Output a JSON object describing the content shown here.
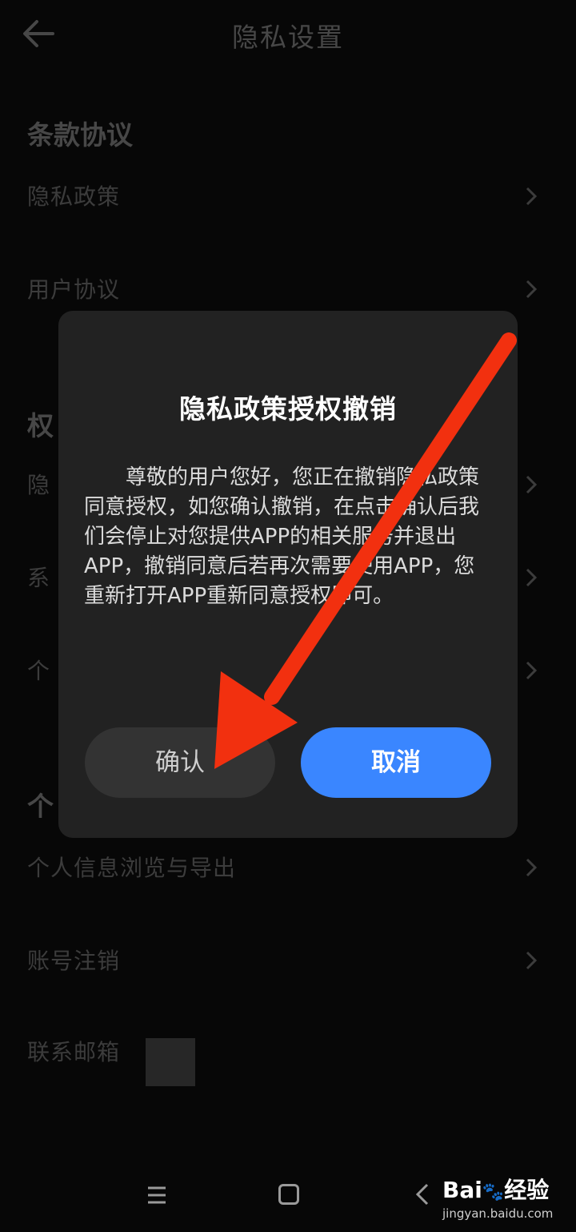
{
  "header": {
    "title": "隐私设置",
    "back_icon": "arrow-left-icon"
  },
  "sections": {
    "terms": {
      "title": "条款协议",
      "items": [
        {
          "label": "隐私政策"
        },
        {
          "label": "用户协议"
        }
      ]
    },
    "permissions": {
      "title_visible": "权",
      "items": [
        {
          "label_visible": "隐"
        },
        {
          "label_visible": "系"
        },
        {
          "label_visible": "个"
        }
      ]
    },
    "personal": {
      "title_visible": "个",
      "items": [
        {
          "label": "个人信息浏览与导出"
        },
        {
          "label": "账号注销"
        },
        {
          "label": "联系邮箱"
        }
      ]
    }
  },
  "dialog": {
    "title": "隐私政策授权撤销",
    "body": "尊敬的用户您好，您正在撤销隐私政策同意授权，如您确认撤销，在点击确认后我们会停止对您提供APP的相关服务并退出APP，撤销同意后若再次需要使用APP，您重新打开APP重新同意授权即可。",
    "confirm_label": "确认",
    "cancel_label": "取消",
    "cancel_color": "#3a86ff"
  },
  "annotation": {
    "arrow_color": "#f2300f"
  },
  "navbar": {
    "icons": [
      "menu-icon",
      "home-icon",
      "back-icon"
    ]
  },
  "watermark": {
    "brand": "Bai",
    "brand_suffix": "经验",
    "url": "jingyan.baidu.com"
  }
}
